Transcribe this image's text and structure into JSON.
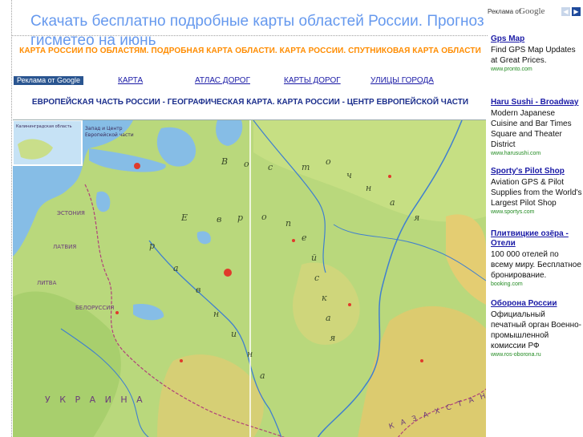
{
  "header": {
    "title": "Скачать бесплатно подробные карты областей России. Прогноз гисметео на июнь",
    "tagline": "КАРТА РОССИИ ПО ОБЛАСТЯМ. ПОДРОБНАЯ КАРТА ОБЛАСТИ. КАРТА РОССИИ. СПУТНИКОВАЯ КАРТА ОБЛАСТИ"
  },
  "adbar": {
    "badge": "Реклама от Google",
    "links": [
      "КАРТА",
      "АТЛАС ДОРОГ",
      "КАРТЫ ДОРОГ",
      "УЛИЦЫ ГОРОДА"
    ]
  },
  "subtitle": "ЕВРОПЕЙСКАЯ ЧАСТЬ РОССИИ - ГЕОГРАФИЧЕСКАЯ КАРТА. КАРТА РОССИИ - ЦЕНТР ЕВРОПЕЙСКОЙ ЧАСТИ",
  "map": {
    "inset_labels": [
      "Калининградская область",
      "Запад и Центр",
      "Европейской части"
    ],
    "region_labels": [
      "ЭСТОНИЯ",
      "ЛАТВИЯ",
      "ЛИТВА",
      "БЕЛОРУССИЯ",
      "У К Р А И Н А",
      "К А З А Х С Т А Н"
    ],
    "big_letters": [
      "В",
      "о",
      "с",
      "т",
      "о",
      "ч",
      "н",
      "а",
      "я",
      "Е",
      "в",
      "р",
      "о",
      "п",
      "е",
      "й",
      "с",
      "к",
      "а",
      "я",
      "р",
      "а",
      "в",
      "н",
      "и",
      "н",
      "а"
    ],
    "colors": {
      "land": "#b7d77a",
      "highland": "#e7cf74",
      "water": "#7fb6e3",
      "river": "#3f7fd0",
      "city": "#e03a2b"
    }
  },
  "sidebar": {
    "label": "Реклама от",
    "brand": "Google",
    "ads": [
      {
        "title": "Gps Map",
        "desc": "Find GPS Map Updates at Great Prices.",
        "url": "www.pronto.com"
      },
      {
        "title": "Haru Sushi - Broadway",
        "desc": "Modern Japanese Cuisine and Bar Times Square and Theater District",
        "url": "www.harusushi.com"
      },
      {
        "title": "Sporty's Pilot Shop",
        "desc": "Aviation GPS & Pilot Supplies from the World's Largest Pilot Shop",
        "url": "www.sportys.com"
      },
      {
        "title": "Плитвицкие озёра - Отели",
        "desc": "100 000 отелей по всему миру. Бесплатное бронирование.",
        "url": "booking.com"
      },
      {
        "title": "Оборона России",
        "desc": "Официальный печатный орган Военно-промышленной комиссии РФ",
        "url": "www.ros-oborona.ru"
      }
    ]
  }
}
